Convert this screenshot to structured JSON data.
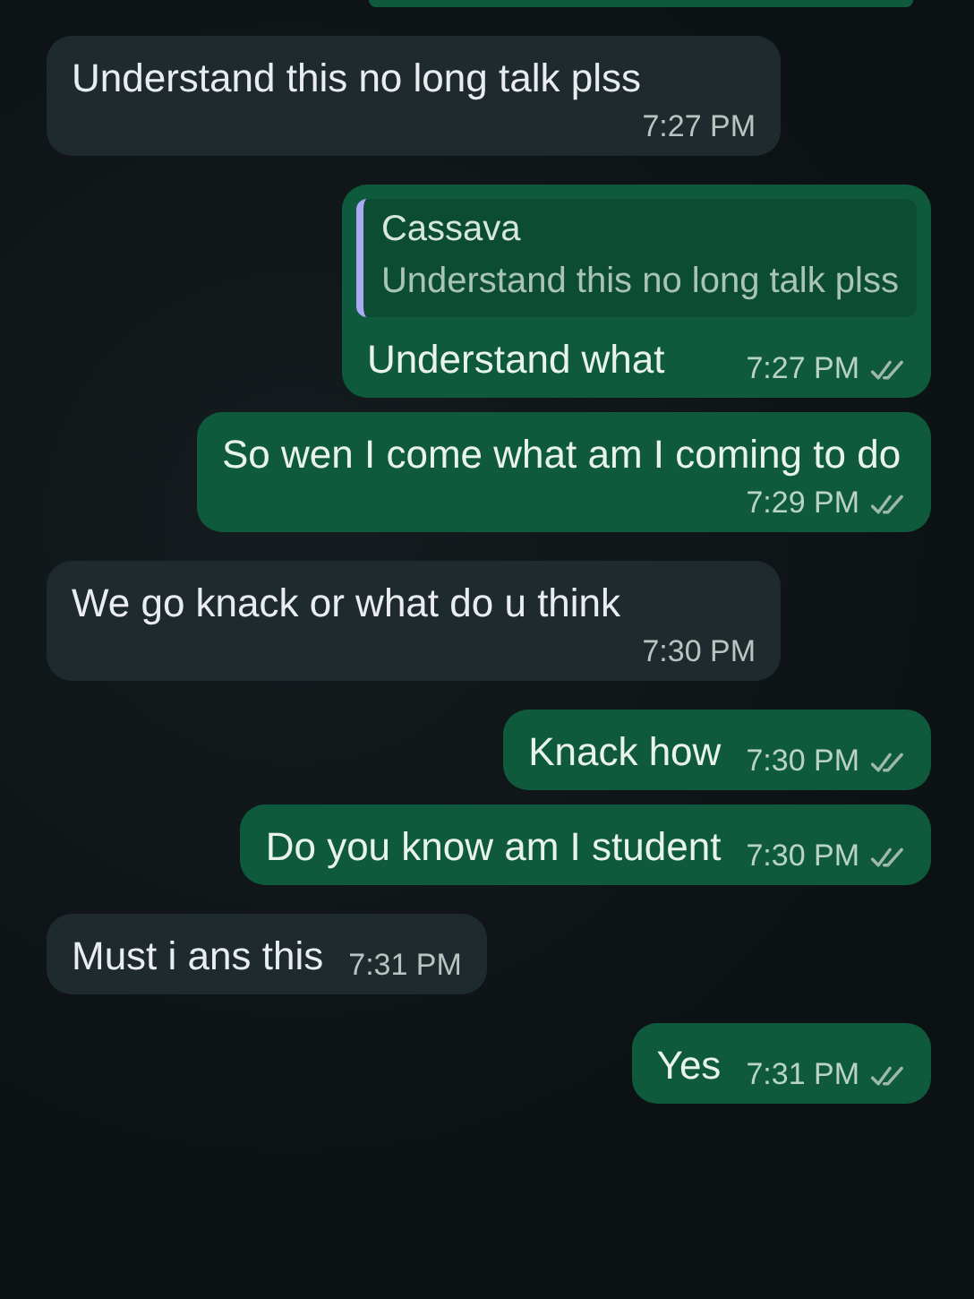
{
  "messages": [
    {
      "kind": "incoming",
      "text": "Understand this no long talk plss",
      "time": "7:27 PM"
    },
    {
      "kind": "outgoing",
      "reply": {
        "author": "Cassava",
        "text": "Understand this no long talk plss"
      },
      "text": "Understand what",
      "time": "7:27 PM",
      "delivered": true
    },
    {
      "kind": "outgoing",
      "text": "So wen I come what am I coming to do",
      "time": "7:29 PM",
      "delivered": true
    },
    {
      "kind": "incoming",
      "text": "We go knack or what do u think",
      "time": "7:30 PM"
    },
    {
      "kind": "outgoing",
      "text": "Knack how",
      "time": "7:30 PM",
      "delivered": true
    },
    {
      "kind": "outgoing",
      "text": "Do you know am I student",
      "time": "7:30 PM",
      "delivered": true
    },
    {
      "kind": "incoming",
      "text": "Must i ans this",
      "time": "7:31 PM"
    },
    {
      "kind": "outgoing",
      "text": "Yes",
      "time": "7:31 PM",
      "delivered": true
    }
  ]
}
